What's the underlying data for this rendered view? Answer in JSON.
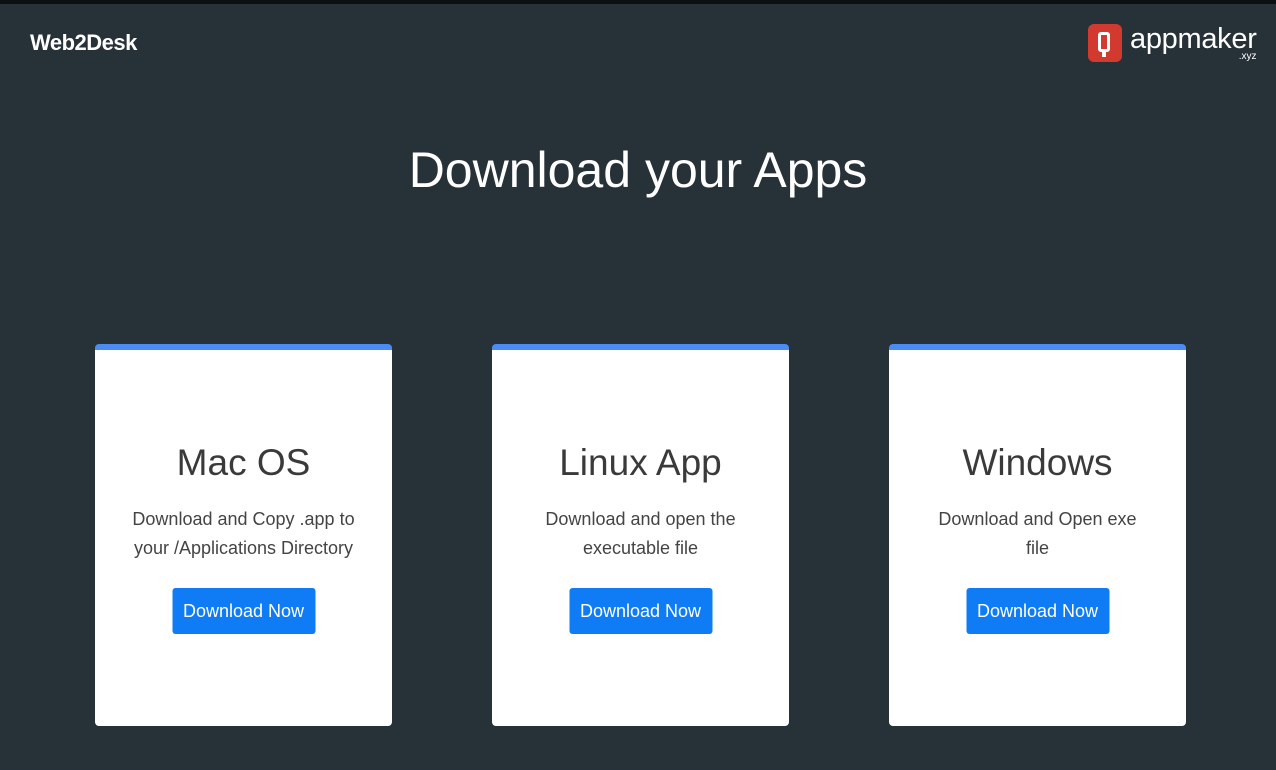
{
  "header": {
    "brand": "Web2Desk",
    "partner_logo": {
      "name": "appmaker",
      "tld": ".xyz",
      "icon": "appmaker-logo-icon",
      "color": "#d23a2f"
    }
  },
  "main": {
    "title": "Download your Apps",
    "cards": [
      {
        "title": "Mac OS",
        "description": "Download and Copy .app to your /Applications Directory",
        "button_label": "Download Now"
      },
      {
        "title": "Linux App",
        "description": "Download and open the executable file",
        "button_label": "Download Now"
      },
      {
        "title": "Windows",
        "description": "Download and Open exe file",
        "button_label": "Download Now"
      }
    ]
  },
  "colors": {
    "background": "#273138",
    "card_accent": "#4b8bf5",
    "button": "#0f7cf6"
  }
}
